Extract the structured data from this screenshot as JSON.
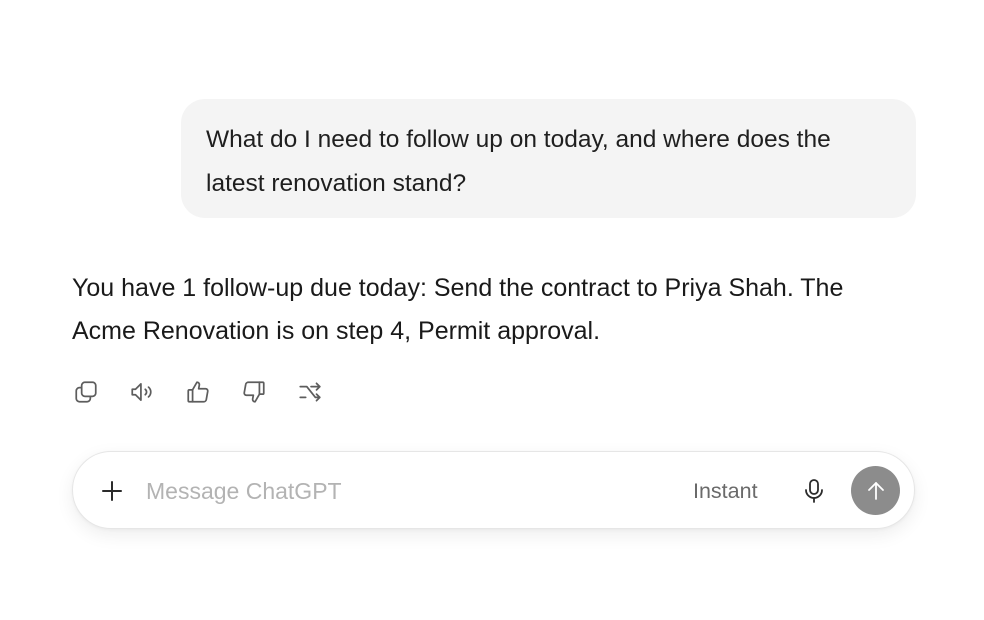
{
  "conversation": {
    "user_message": "What do I need to follow up on today, and where does the latest renovation stand?",
    "assistant_message": "You have 1 follow-up due today: Send the contract to Priya Shah. The Acme Renovation is on step 4, Permit approval."
  },
  "message_actions": [
    {
      "name": "copy",
      "icon": "copy-icon"
    },
    {
      "name": "read-aloud",
      "icon": "speaker-icon"
    },
    {
      "name": "good-response",
      "icon": "thumbs-up-icon"
    },
    {
      "name": "bad-response",
      "icon": "thumbs-down-icon"
    },
    {
      "name": "switch-model",
      "icon": "shuffle-icon"
    }
  ],
  "composer": {
    "placeholder": "Message ChatGPT",
    "value": "",
    "mode_label": "Instant",
    "add_icon": "plus-icon",
    "mic_icon": "microphone-icon",
    "send_icon": "arrow-up-icon",
    "send_button_color": "#8c8c8c"
  }
}
